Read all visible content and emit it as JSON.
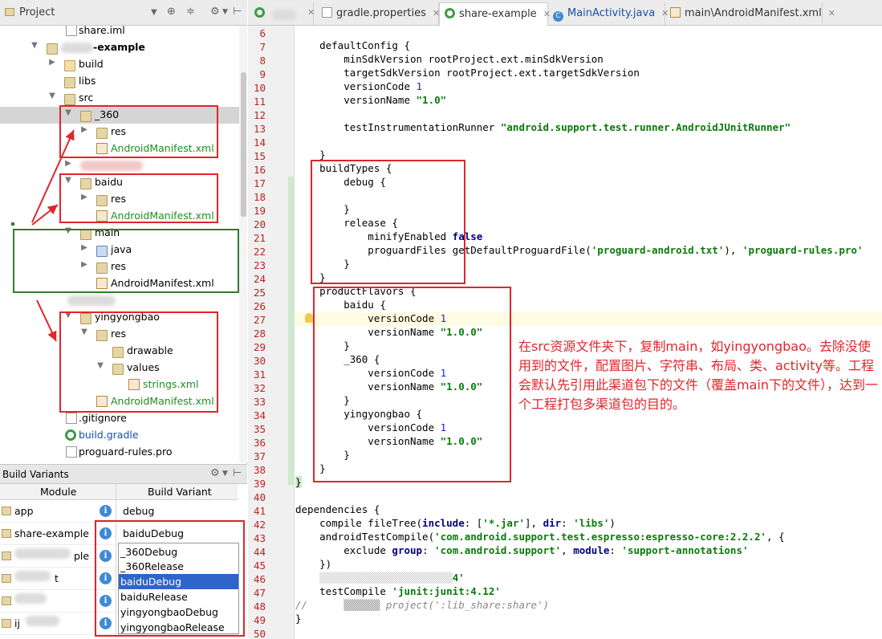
{
  "project_panel": {
    "title": "Project",
    "tree": [
      {
        "label": "share.iml",
        "kind": "file"
      },
      {
        "label": "-example",
        "kind": "module"
      },
      {
        "label": "build",
        "kind": "folder"
      },
      {
        "label": "libs",
        "kind": "folder"
      },
      {
        "label": "src",
        "kind": "folder"
      },
      {
        "label": "_360",
        "kind": "folder"
      },
      {
        "label": "res",
        "kind": "folder"
      },
      {
        "label": "AndroidManifest.xml",
        "kind": "xml"
      },
      {
        "label": "baidu",
        "kind": "folder"
      },
      {
        "label": "res",
        "kind": "folder"
      },
      {
        "label": "AndroidManifest.xml",
        "kind": "xml"
      },
      {
        "label": "main",
        "kind": "folder"
      },
      {
        "label": "java",
        "kind": "folder"
      },
      {
        "label": "res",
        "kind": "folder"
      },
      {
        "label": "AndroidManifest.xml",
        "kind": "xml"
      },
      {
        "label": "yingyongbao",
        "kind": "folder"
      },
      {
        "label": "res",
        "kind": "folder"
      },
      {
        "label": "drawable",
        "kind": "folder"
      },
      {
        "label": "values",
        "kind": "folder"
      },
      {
        "label": "strings.xml",
        "kind": "xml"
      },
      {
        "label": "AndroidManifest.xml",
        "kind": "xml"
      },
      {
        "label": ".gitignore",
        "kind": "file"
      },
      {
        "label": "build.gradle",
        "kind": "gradle"
      },
      {
        "label": "proguard-rules.pro",
        "kind": "file"
      }
    ]
  },
  "build_variants": {
    "title": "Build Variants",
    "col_module": "Module",
    "col_variant": "Build Variant",
    "rows": [
      {
        "module": "app",
        "variant": "debug"
      },
      {
        "module": "share-example",
        "variant": "baiduDebug"
      },
      {
        "module": "ple",
        "variant": ""
      },
      {
        "module": "t",
        "variant": ""
      },
      {
        "module": "",
        "variant": ""
      },
      {
        "module": "ij",
        "variant": ""
      }
    ],
    "dropdown": [
      "_360Debug",
      "_360Release",
      "baiduDebug",
      "baiduRelease",
      "yingyongbaoDebug",
      "yingyongbaoRelease"
    ],
    "selected_option": "baiduDebug"
  },
  "tabs": [
    {
      "label": "",
      "icon": "gradle-icon"
    },
    {
      "label": "gradle.properties",
      "icon": "file-icon"
    },
    {
      "label": "share-example",
      "icon": "gradle-icon",
      "active": true
    },
    {
      "label": "MainActivity.java",
      "icon": "class-icon"
    },
    {
      "label": "main\\AndroidManifest.xml",
      "icon": "xml-icon"
    }
  ],
  "line_numbers": [
    "6",
    "7",
    "8",
    "9",
    "10",
    "11",
    "12",
    "13",
    "14",
    "15",
    "16",
    "17",
    "18",
    "19",
    "20",
    "21",
    "22",
    "23",
    "24",
    "25",
    "26",
    "27",
    "28",
    "29",
    "30",
    "31",
    "32",
    "33",
    "34",
    "35",
    "36",
    "37",
    "38",
    "39",
    "40",
    "41",
    "42",
    "43",
    "44",
    "45",
    "46",
    "47",
    "48",
    "49",
    "50"
  ],
  "note": "在src资源文件夹下，复制main，如yingyongbao。去除没使用到的文件，配置图片、字符串、布局、类、activity等。工程会默认先引用此渠道包下的文件（覆盖main下的文件），达到一个工程打包多渠道包的目的。",
  "colors": {
    "annotation_red": "#e0252b",
    "annotation_green": "#2e7d2e",
    "string_green": "#0a7a0a",
    "number_blue": "#1a1aff"
  }
}
